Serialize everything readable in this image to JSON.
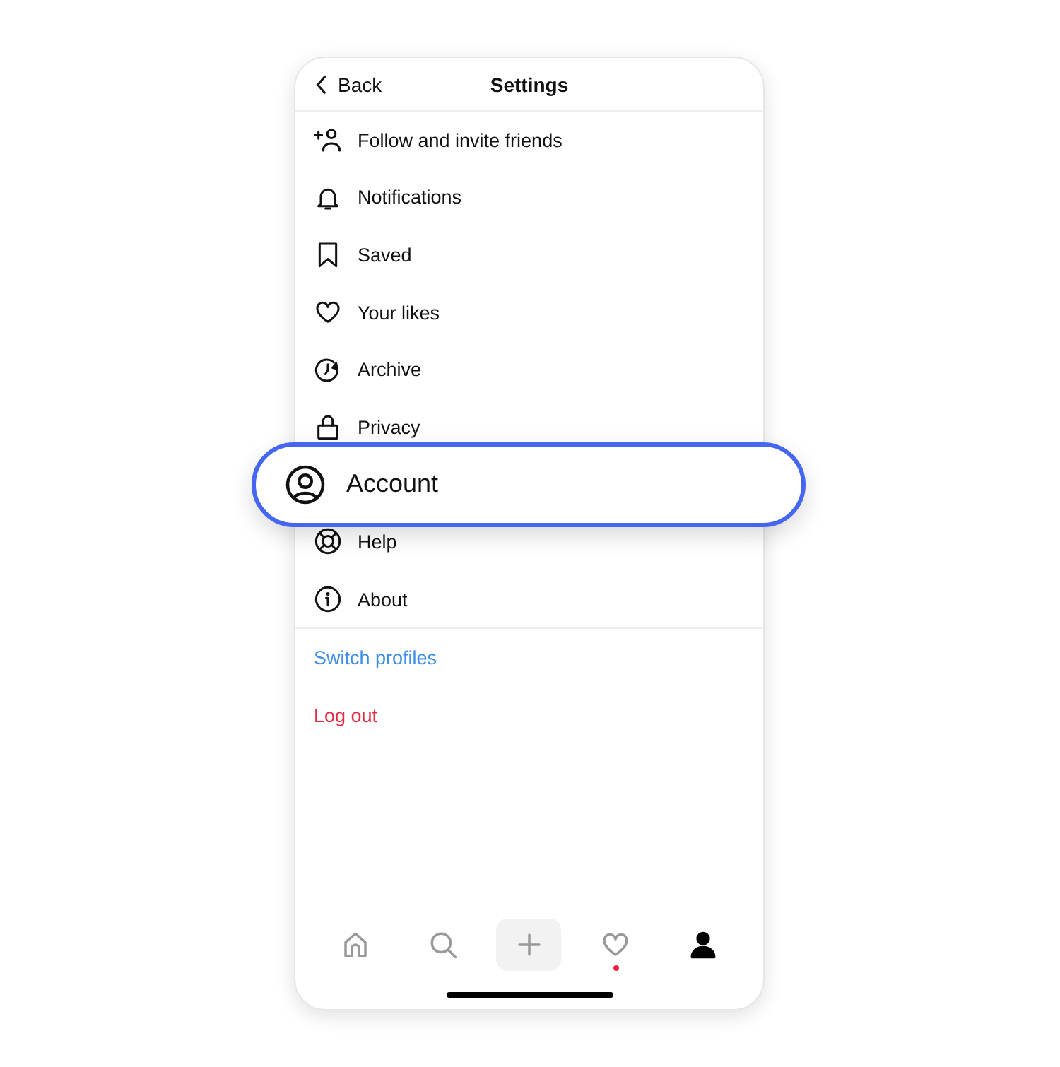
{
  "header": {
    "back": "Back",
    "title": "Settings"
  },
  "menu_items": [
    {
      "label": "Follow and invite friends",
      "highlighted": false
    },
    {
      "label": "Notifications",
      "highlighted": false
    },
    {
      "label": "Saved",
      "highlighted": false
    },
    {
      "label": "Your likes",
      "highlighted": false
    },
    {
      "label": "Archive",
      "highlighted": false
    },
    {
      "label": "Privacy",
      "highlighted": false
    },
    {
      "label": "Account",
      "highlighted": true
    },
    {
      "label": "Help",
      "highlighted": false
    },
    {
      "label": "About",
      "highlighted": false
    }
  ],
  "actions": [
    {
      "label": "Switch profiles",
      "kind": "switch"
    },
    {
      "label": "Log out",
      "kind": "logout"
    }
  ],
  "bottom_nav": [
    {
      "kind": "home",
      "selected": false,
      "badge": false
    },
    {
      "kind": "search",
      "selected": false,
      "badge": false
    },
    {
      "kind": "create",
      "selected": false,
      "badge": false
    },
    {
      "kind": "activity",
      "selected": false,
      "badge": true
    },
    {
      "kind": "profile",
      "selected": true,
      "badge": false
    }
  ]
}
